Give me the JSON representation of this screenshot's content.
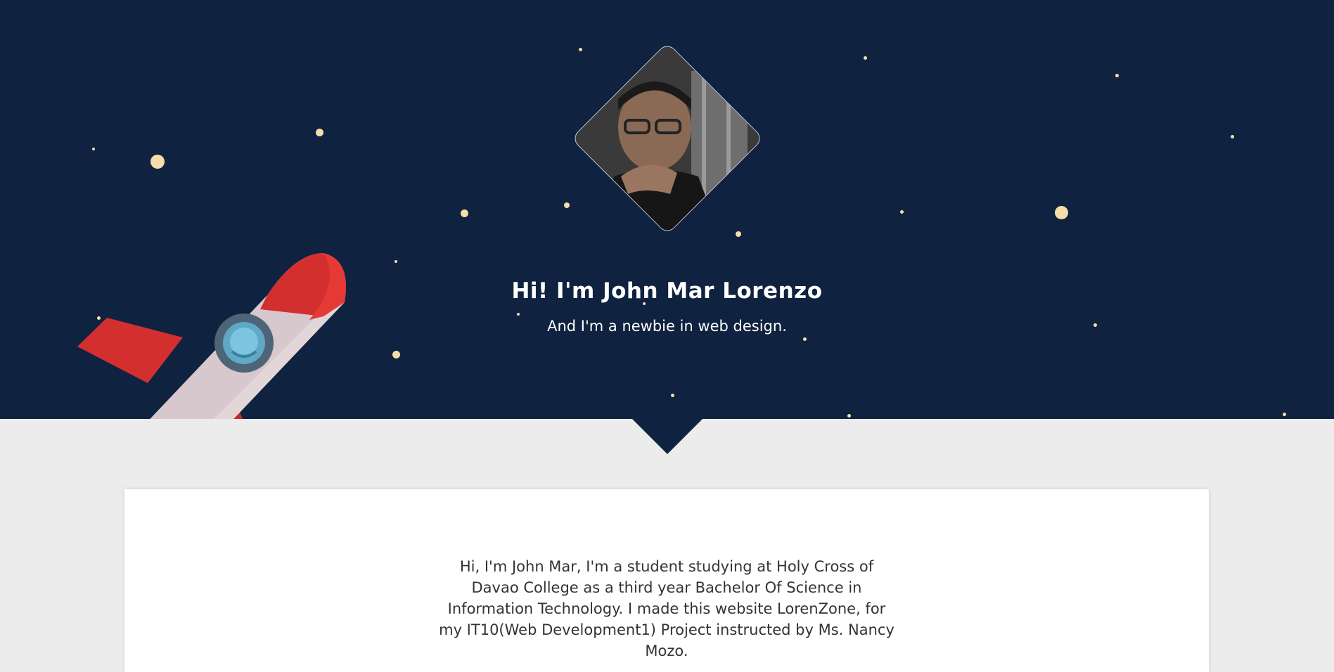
{
  "hero": {
    "title": "Hi! I'm John Mar Lorenzo",
    "subtitle": "And I'm a newbie in web design.",
    "background_color": "#0f2240",
    "star_color": "#f6deaa"
  },
  "about": {
    "text": "Hi, I'm John Mar, I'm a student studying at Holy Cross of Davao College as a third year Bachelor Of Science in Information Technology. I made this website LorenZone, for my IT10(Web Development1) Project instructed by Ms. Nancy Mozo."
  },
  "icons": {
    "avatar": "profile-photo",
    "rocket": "rocket-illustration"
  }
}
